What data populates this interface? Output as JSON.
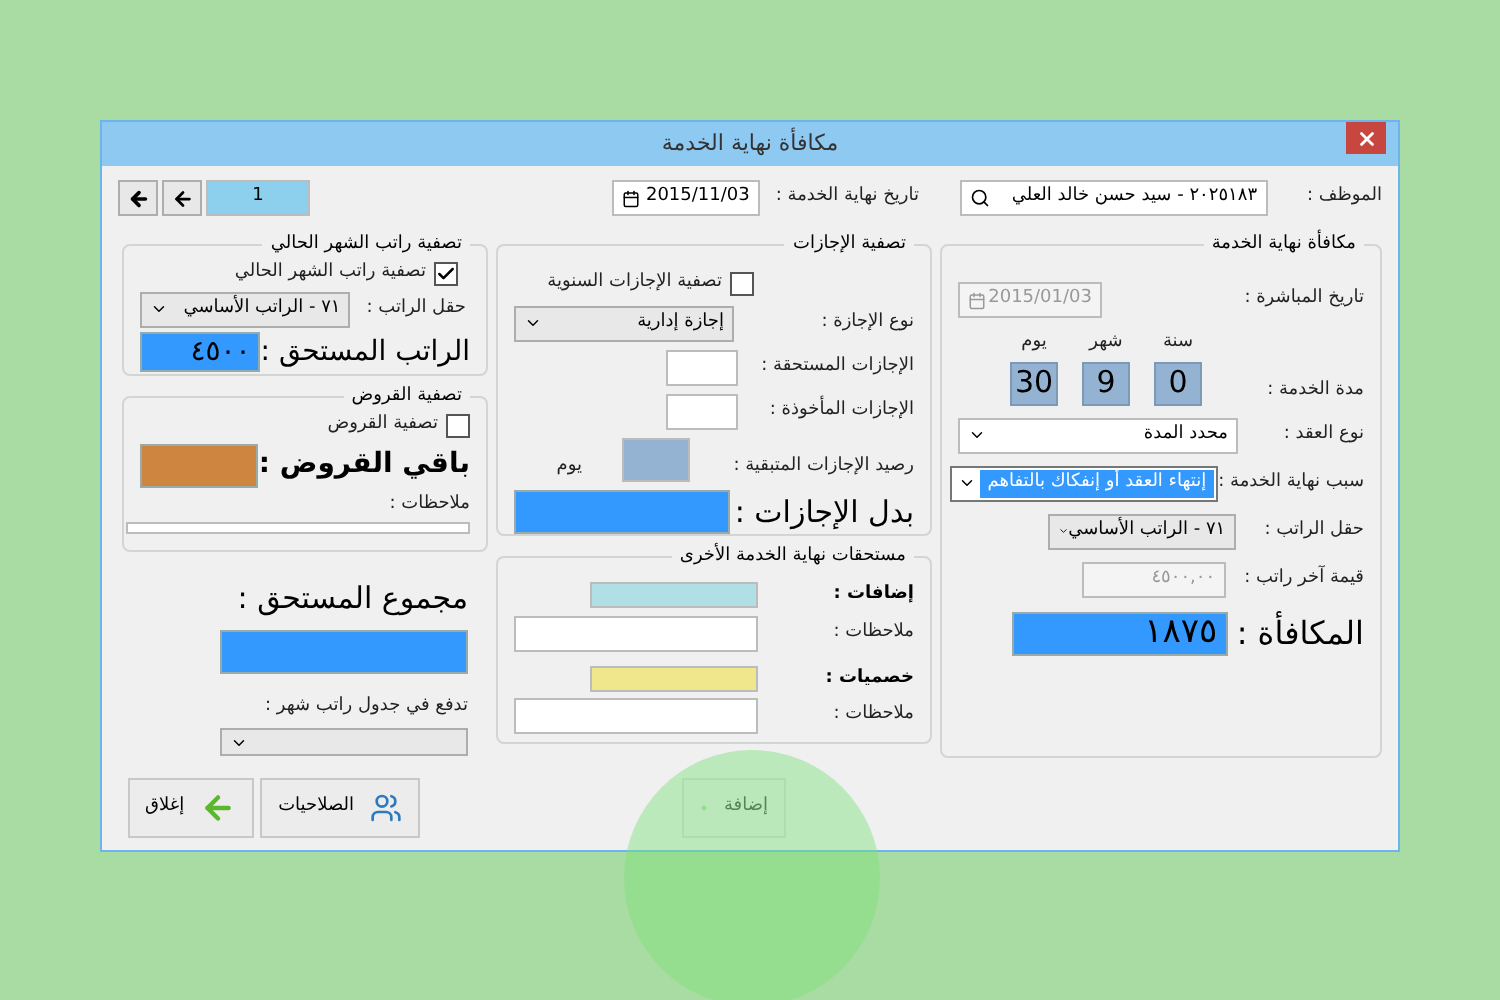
{
  "window": {
    "title": "مكافأة نهاية الخدمة"
  },
  "nav": {
    "page": "1"
  },
  "header": {
    "employee_label": "الموظف :",
    "employee_value": "٢٠٢٥١٨٣ - سيد حسن خالد العلي",
    "end_date_label": "تاريخ نهاية الخدمة :",
    "end_date_value": "2015/11/03"
  },
  "reward": {
    "title": "مكافأة نهاية الخدمة",
    "start_date_label": "تاريخ المباشرة :",
    "start_date_value": "2015/01/03",
    "start_date_disabled": true,
    "duration_label": "مدة الخدمة :",
    "duration": [
      {
        "unit": "سنة",
        "value": "0"
      },
      {
        "unit": "شهر",
        "value": "9"
      },
      {
        "unit": "يوم",
        "value": "30"
      }
    ],
    "contract_label": "نوع العقد :",
    "contract_value": "محدد المدة",
    "reason_label": "سبب نهاية الخدمة :",
    "reason_value": "إنتهاء العقد أو إنفكاك بالتفاهم",
    "salary_field_label": "حقل الراتب :",
    "salary_field_value": "٧١ - الراتب الأساسي",
    "last_salary_label": "قيمة آخر راتب :",
    "last_salary_value": "٤٥٠٠,٠٠",
    "last_salary_disabled": true,
    "reward_label": "المكافأة :",
    "reward_value": "١٨٧٥"
  },
  "leaves": {
    "title": "تصفية الإجازات",
    "settle_label": "تصفية الإجازات السنوية",
    "settle_checked": false,
    "type_label": "نوع الإجازة :",
    "type_value": "إجازة إدارية",
    "due_label": "الإجازات المستحقة :",
    "taken_label": "الإجازات المأخوذة :",
    "balance_label": "رصيد الإجازات المتبقية :",
    "balance_unit": "يوم",
    "allowance_label": "بدل الإجازات :"
  },
  "other": {
    "title": "مستحقات نهاية الخدمة الأخرى",
    "additions_label": "إضافات :",
    "additions_notes_label": "ملاحظات :",
    "deductions_label": "خصميات :",
    "deductions_notes_label": "ملاحظات :"
  },
  "salary": {
    "title": "تصفية راتب الشهر الحالي",
    "settle_label": "تصفية راتب الشهر الحالي",
    "settle_checked": true,
    "field_label": "حقل الراتب :",
    "field_value": "٧١ - الراتب الأساسي",
    "due_label": "الراتب المستحق :",
    "due_value": "٤٥٠٠"
  },
  "loans": {
    "title": "تصفية القروض",
    "settle_label": "تصفية القروض",
    "settle_checked": false,
    "remaining_label": "باقي القروض :",
    "notes_label": "ملاحظات :"
  },
  "total": {
    "label": "مجموع المستحق :",
    "pay_label": "تدفع في جدول راتب شهر :"
  },
  "buttons": [
    {
      "label": "إضافة",
      "kind": "add",
      "disabled": true
    },
    {
      "label": "الصلاحيات",
      "kind": "permissions",
      "disabled": false
    },
    {
      "label": "إغلاق",
      "kind": "close",
      "disabled": false
    }
  ]
}
